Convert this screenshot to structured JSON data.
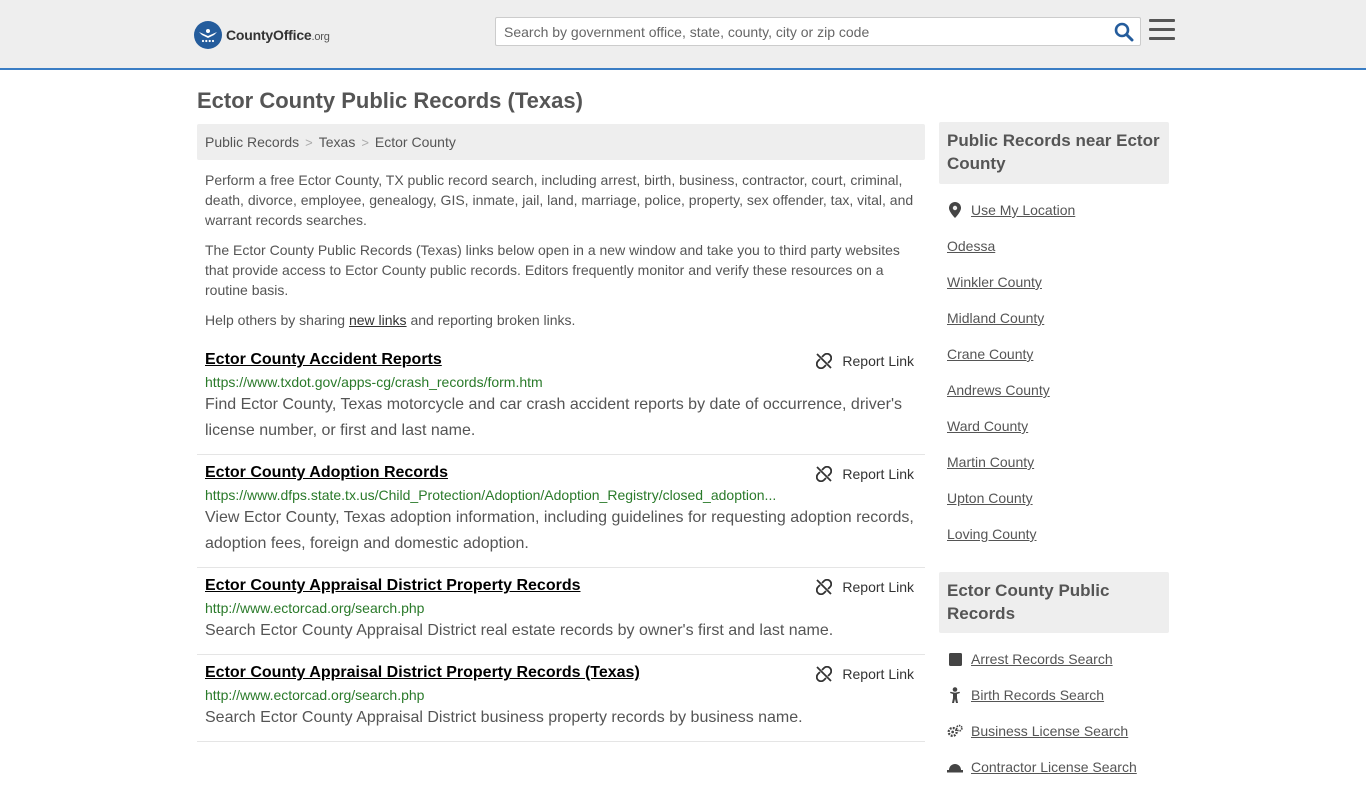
{
  "header": {
    "logo_main": "CountyOffice",
    "logo_suffix": ".org",
    "search_placeholder": "Search by government office, state, county, city or zip code"
  },
  "page": {
    "title": "Ector County Public Records (Texas)"
  },
  "breadcrumb": [
    "Public Records",
    "Texas",
    "Ector County"
  ],
  "intro": {
    "p1": "Perform a free Ector County, TX public record search, including arrest, birth, business, contractor, court, criminal, death, divorce, employee, genealogy, GIS, inmate, jail, land, marriage, police, property, sex offender, tax, vital, and warrant records searches.",
    "p2": "The Ector County Public Records (Texas) links below open in a new window and take you to third party websites that provide access to Ector County public records. Editors frequently monitor and verify these resources on a routine basis.",
    "p3_before": "Help others by sharing ",
    "p3_link": "new links",
    "p3_after": " and reporting broken links."
  },
  "report_label": "Report Link",
  "records": [
    {
      "title": "Ector County Accident Reports",
      "url": "https://www.txdot.gov/apps-cg/crash_records/form.htm",
      "desc": "Find Ector County, Texas motorcycle and car crash accident reports by date of occurrence, driver's license number, or first and last name."
    },
    {
      "title": "Ector County Adoption Records",
      "url": "https://www.dfps.state.tx.us/Child_Protection/Adoption/Adoption_Registry/closed_adoption...",
      "desc": "View Ector County, Texas adoption information, including guidelines for requesting adoption records, adoption fees, foreign and domestic adoption."
    },
    {
      "title": "Ector County Appraisal District Property Records",
      "url": "http://www.ectorcad.org/search.php",
      "desc": "Search Ector County Appraisal District real estate records by owner's first and last name."
    },
    {
      "title": "Ector County Appraisal District Property Records (Texas)",
      "url": "http://www.ectorcad.org/search.php",
      "desc": "Search Ector County Appraisal District business property records by business name."
    }
  ],
  "sidebar": {
    "nearby_title": "Public Records near Ector County",
    "use_location": "Use My Location",
    "nearby": [
      "Odessa",
      "Winkler County",
      "Midland County",
      "Crane County",
      "Andrews County",
      "Ward County",
      "Martin County",
      "Upton County",
      "Loving County"
    ],
    "county_title": "Ector County Public Records",
    "county_links": [
      {
        "label": "Arrest Records Search",
        "icon": "square-icon"
      },
      {
        "label": "Birth Records Search",
        "icon": "baby-icon"
      },
      {
        "label": "Business License Search",
        "icon": "gears-icon"
      },
      {
        "label": "Contractor License Search",
        "icon": "hardhat-icon"
      }
    ]
  },
  "colors": {
    "accent": "#3a7dc4",
    "url_green": "#2a7a2a",
    "header_bg": "#eeeeee"
  }
}
